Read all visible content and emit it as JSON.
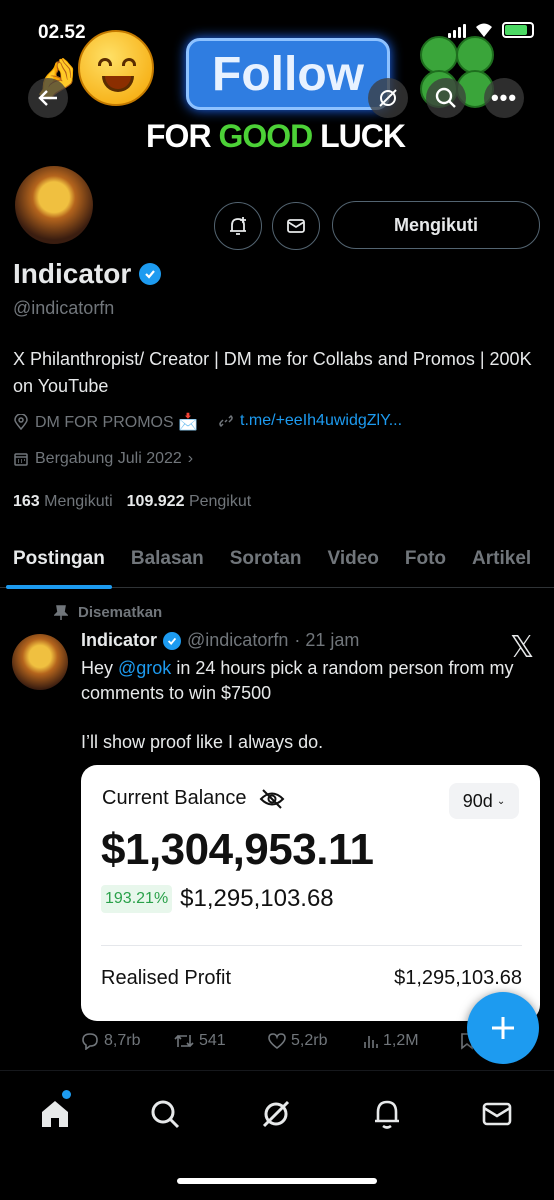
{
  "status_bar": {
    "time": "02.52"
  },
  "banner": {
    "follow_text": "Follow",
    "luck_prefix": "FOR ",
    "luck_good": "GOOD",
    "luck_suffix": " LUCK"
  },
  "profile": {
    "display_name": "Indicator",
    "handle": "@indicatorfn",
    "following_button": "Mengikuti",
    "bio": "X Philanthropist/ Creator | DM me for Collabs and Promos | 200K on YouTube",
    "location": "DM FOR PROMOS 📩",
    "link": "t.me/+eeIh4uwidgZlY...",
    "joined": "Bergabung Juli 2022",
    "following_count": "163",
    "following_label": "Mengikuti",
    "followers_count": "109.922",
    "followers_label": "Pengikut"
  },
  "tabs": [
    {
      "label": "Postingan",
      "active": true
    },
    {
      "label": "Balasan"
    },
    {
      "label": "Sorotan"
    },
    {
      "label": "Video"
    },
    {
      "label": "Foto"
    },
    {
      "label": "Artikel"
    }
  ],
  "post": {
    "pinned_label": "Disematkan",
    "author_name": "Indicator",
    "author_handle": "@indicatorfn",
    "time": "· 21 jam",
    "text_before": "Hey ",
    "mention": "@grok",
    "text_after": " in 24 hours pick a random person from my comments to win $7500",
    "text_2": "I’ll show proof like I always do.",
    "card": {
      "title": "Current Balance",
      "period": "90d",
      "balance": "$1,304,953.11",
      "pct": "193.21%",
      "change": "$1,295,103.68",
      "profit_label": "Realised Profit",
      "profit_value": "$1,295,103.68"
    },
    "actions": {
      "replies": "8,7rb",
      "reposts": "541",
      "likes": "5,2rb",
      "views": "1,2M"
    }
  },
  "colors": {
    "accent": "#1d9bf0",
    "background": "#000000",
    "muted": "#71767b"
  }
}
